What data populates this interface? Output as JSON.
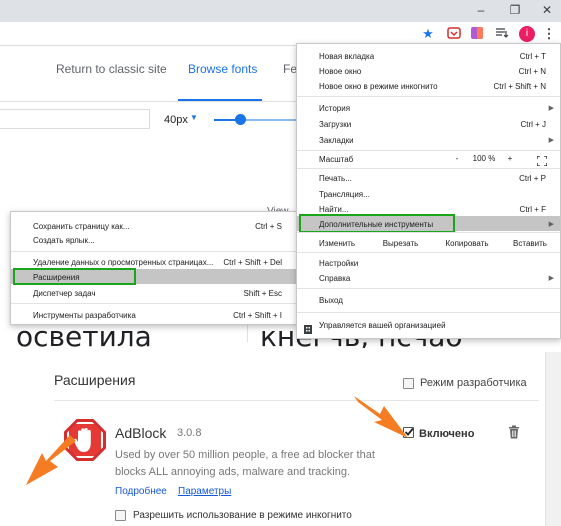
{
  "browser": {
    "window_controls": [
      "–",
      "❐",
      "✕"
    ],
    "avatar_letter": "i",
    "colors": {
      "accent": "#1a73e8",
      "avatar": "#e91e63",
      "highlight_box": "#1aa61a",
      "arrow_orange": "#f57c22"
    }
  },
  "fonts_page": {
    "nav": {
      "classic": "Return to classic site",
      "browse": "Browse fonts",
      "partial": "Fe"
    },
    "size_value": "40px",
    "size_caret": "▼",
    "view_label": "View",
    "sample_left": "осветила",
    "sample_right": "кнегчь, псчао"
  },
  "page_context_menu": {
    "items": [
      {
        "label": "Сохранить страницу как...",
        "shortcut": "Ctrl + S"
      },
      {
        "label": "Создать ярлык...",
        "shortcut": ""
      },
      {
        "label": "Удаление данных о просмотренных страницах...",
        "shortcut": "Ctrl + Shift + Del"
      },
      {
        "label": "Расширения",
        "shortcut": ""
      },
      {
        "label": "Диспетчер задач",
        "shortcut": "Shift + Esc"
      },
      {
        "label": "Инструменты разработчика",
        "shortcut": "Ctrl + Shift + I"
      }
    ]
  },
  "chrome_menu": {
    "new_tab": {
      "label": "Новая вкладка",
      "shortcut": "Ctrl + T"
    },
    "new_window": {
      "label": "Новое окно",
      "shortcut": "Ctrl + N"
    },
    "incognito": {
      "label": "Новое окно в режиме инкогнито",
      "shortcut": "Ctrl + Shift + N"
    },
    "history": {
      "label": "История"
    },
    "downloads": {
      "label": "Загрузки",
      "shortcut": "Ctrl + J"
    },
    "bookmarks": {
      "label": "Закладки"
    },
    "zoom": {
      "label": "Масштаб",
      "minus": "-",
      "value": "100 %",
      "plus": "+"
    },
    "print": {
      "label": "Печать...",
      "shortcut": "Ctrl + P"
    },
    "cast": {
      "label": "Трансляция..."
    },
    "find": {
      "label": "Найти...",
      "shortcut": "Ctrl + F"
    },
    "more_tools": {
      "label": "Дополнительные инструменты"
    },
    "edit": {
      "label": "Изменить",
      "cut": "Вырезать",
      "copy": "Копировать",
      "paste": "Вставить"
    },
    "settings": {
      "label": "Настройки"
    },
    "help": {
      "label": "Справка"
    },
    "exit": {
      "label": "Выход"
    },
    "managed": {
      "label": "Управляется вашей организацией"
    }
  },
  "extensions_page": {
    "title": "Расширения",
    "dev_mode": "Режим разработчика",
    "extension": {
      "name": "AdBlock",
      "version": "3.0.8",
      "description": "Used by over 50 million people, a free ad blocker that blocks ALL annoying ads, malware and tracking.",
      "details_link": "Подробнее",
      "options_link": "Параметры",
      "enabled_label": "Включено",
      "enabled": true,
      "incognito_label": "Разрешить использование в режиме инкогнито"
    }
  }
}
